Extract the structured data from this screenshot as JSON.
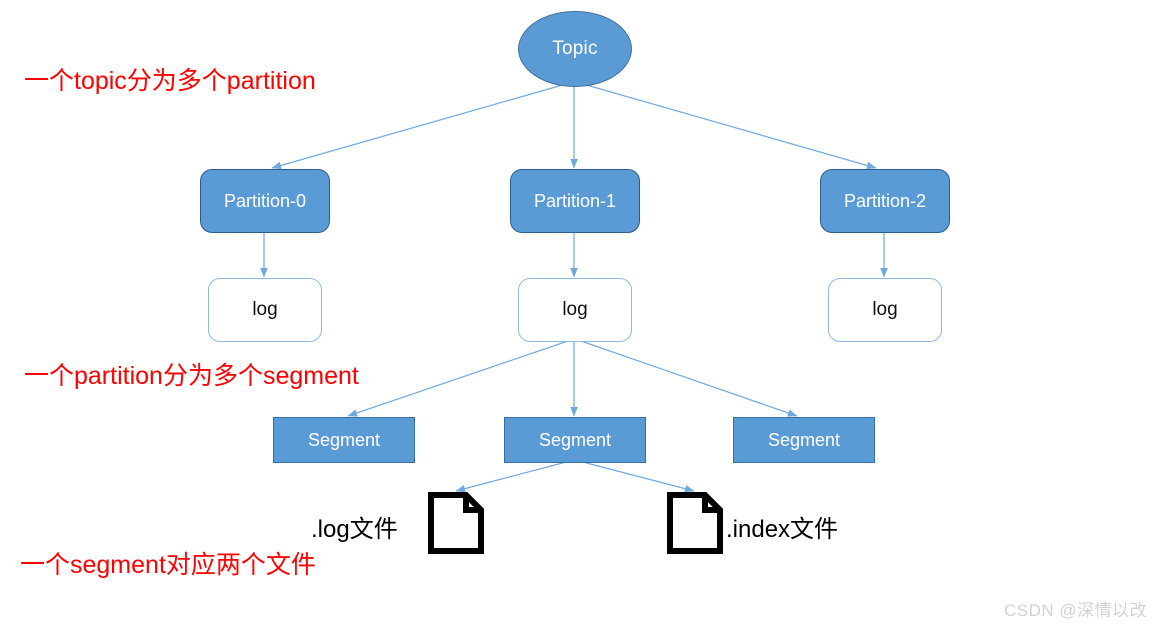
{
  "diagram": {
    "title_node": {
      "label": "Topic"
    },
    "partitions": [
      {
        "label": "Partition-0"
      },
      {
        "label": "Partition-1"
      },
      {
        "label": "Partition-2"
      }
    ],
    "logs": [
      {
        "label": "log"
      },
      {
        "label": "log"
      },
      {
        "label": "log"
      }
    ],
    "segments": [
      {
        "label": "Segment"
      },
      {
        "label": "Segment"
      },
      {
        "label": "Segment"
      }
    ],
    "files": [
      {
        "label": ".log文件",
        "icon": "document-icon"
      },
      {
        "label": ".index文件",
        "icon": "document-icon"
      }
    ],
    "annotations": [
      {
        "text": "一个topic分为多个partition"
      },
      {
        "text": "一个partition分为多个segment"
      },
      {
        "text": "一个segment对应两个文件"
      }
    ],
    "watermark": "CSDN @深情以改",
    "colors": {
      "node_fill": "#5B9BD5",
      "node_border": "#41719C",
      "log_border": "#8FB9E0",
      "edge": "#6FA8DC",
      "annotation": "#FF0000",
      "watermark": "#D2D2D2",
      "background": "#FFFFFF"
    }
  }
}
